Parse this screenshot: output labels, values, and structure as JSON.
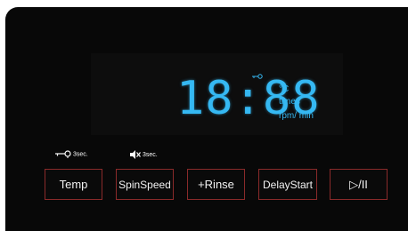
{
  "display": {
    "time": "18:88",
    "unit_celsius": "°C",
    "unit_times": "times",
    "unit_rpm": "rpm/ min"
  },
  "hints": {
    "temp_lock_duration": "3sec.",
    "spin_mute_duration": "3sec."
  },
  "buttons": {
    "temp": "Temp",
    "spin_speed": "SpinSpeed",
    "rinse": "+Rinse",
    "delay_start": "DelayStart",
    "start_pause": "▷/II"
  },
  "colors": {
    "lcd": "#35b8f2",
    "button_border": "#8a2a2a",
    "panel": "#080808"
  },
  "icons": {
    "lcd_lock": "key-lock-icon",
    "temp_hint": "key-lock-icon",
    "spin_hint": "mute-icon"
  }
}
